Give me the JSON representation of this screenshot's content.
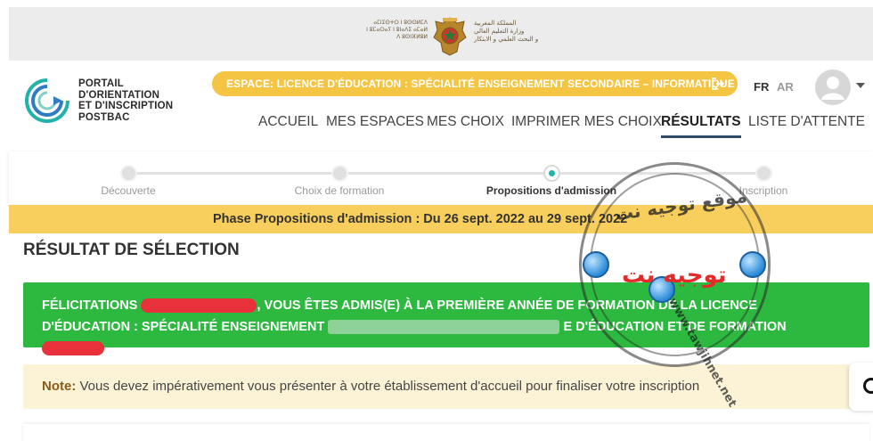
{
  "ministry": {
    "tifinagh": "ⴰⵎⵏⵉⵙⵜⵔ ⵏ ⵓⵙⵙⵍⵎⴷ\nⵏ ⵓⵎⴰⵔⴰⵢ ⵏ ⵓⵏⴰⴷⵉ ⴰⵎⴰⵍ\nⴷ ⵓⵙⵏⴼⵍⵓⵍ",
    "arabic": "المملكة المغربية\nوزارة التعليم العالي\nو البحث العلمي و الابتكار",
    "emblem_icon": "coat-of-arms-icon"
  },
  "logo": {
    "text": "PORTAIL\nD'ORIENTATION\nET D'INSCRIPTION\nPOSTBAC",
    "icon": "circular-arrow-logo-icon",
    "colors": {
      "teal": "#22b3a8",
      "blue": "#2f7cc3"
    }
  },
  "space": {
    "label": "ESPACE: LICENCE D'ÉDUCATION : SPÉCIALITÉ ENSEIGNEMENT SECONDAIRE – INFORMATIQUE",
    "exit_icon": "logout-icon",
    "color": "#f4c542"
  },
  "languages": {
    "fr": "FR",
    "ar": "AR"
  },
  "user": {
    "avatar_icon": "user-avatar-icon",
    "caret_icon": "caret-down-icon"
  },
  "nav": {
    "items": [
      {
        "label": "ACCUEIL"
      },
      {
        "label": "MES ESPACES"
      },
      {
        "label": "MES CHOIX"
      },
      {
        "label": "IMPRIMER MES CHOIX"
      },
      {
        "label": "RÉSULTATS",
        "active": true
      },
      {
        "label": "LISTE D'ATTENTE"
      }
    ]
  },
  "stepper": {
    "steps": [
      {
        "label": "Découverte"
      },
      {
        "label": "Choix de formation"
      },
      {
        "label": "Propositions d'admission",
        "current": true
      },
      {
        "label": "Inscription"
      }
    ],
    "accent": "#22b3a8"
  },
  "phase": {
    "text": "Phase Propositions d'admission : Du 26 sept. 2022 au 29 sept. 2022",
    "color": "#f8ce5c"
  },
  "result": {
    "title": "RÉSULTAT DE SÉLECTION",
    "line1_prefix": "FÉLICITATIONS",
    "line1_suffix": ", VOUS ÊTES ADMIS(E) À LA PREMIÈRE ANNÉE DE FORMATION DE LA LICENCE",
    "line2_prefix": "D'ÉDUCATION : SPÉCIALITÉ ENSEIGNEMENT",
    "line2_suffix": "E D'ÉDUCATION ET DE FORMATION",
    "color": "#2db83f"
  },
  "note": {
    "label": "Note:",
    "text": " Vous devez impérativement vous présenter à votre établissement d'accueil pour finaliser votre inscription",
    "background": "#fcf3d6"
  },
  "watermark": {
    "arabic_top": "موقع توجيه نت",
    "brand": "توجيه نت",
    "url": "www.tawjihnet.net"
  },
  "chat": {
    "icon": "chat-icon"
  }
}
